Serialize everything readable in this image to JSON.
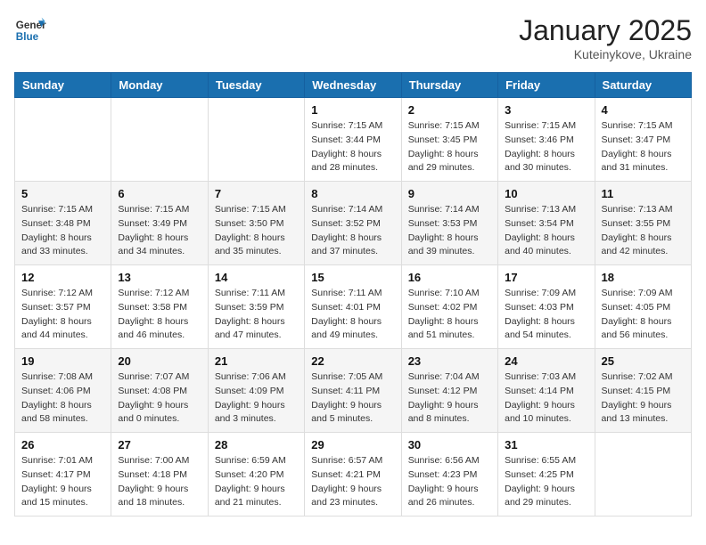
{
  "header": {
    "logo_general": "General",
    "logo_blue": "Blue",
    "month_title": "January 2025",
    "location": "Kuteinykove, Ukraine"
  },
  "days_of_week": [
    "Sunday",
    "Monday",
    "Tuesday",
    "Wednesday",
    "Thursday",
    "Friday",
    "Saturday"
  ],
  "weeks": [
    [
      {
        "day": "",
        "info": ""
      },
      {
        "day": "",
        "info": ""
      },
      {
        "day": "",
        "info": ""
      },
      {
        "day": "1",
        "info": "Sunrise: 7:15 AM\nSunset: 3:44 PM\nDaylight: 8 hours\nand 28 minutes."
      },
      {
        "day": "2",
        "info": "Sunrise: 7:15 AM\nSunset: 3:45 PM\nDaylight: 8 hours\nand 29 minutes."
      },
      {
        "day": "3",
        "info": "Sunrise: 7:15 AM\nSunset: 3:46 PM\nDaylight: 8 hours\nand 30 minutes."
      },
      {
        "day": "4",
        "info": "Sunrise: 7:15 AM\nSunset: 3:47 PM\nDaylight: 8 hours\nand 31 minutes."
      }
    ],
    [
      {
        "day": "5",
        "info": "Sunrise: 7:15 AM\nSunset: 3:48 PM\nDaylight: 8 hours\nand 33 minutes."
      },
      {
        "day": "6",
        "info": "Sunrise: 7:15 AM\nSunset: 3:49 PM\nDaylight: 8 hours\nand 34 minutes."
      },
      {
        "day": "7",
        "info": "Sunrise: 7:15 AM\nSunset: 3:50 PM\nDaylight: 8 hours\nand 35 minutes."
      },
      {
        "day": "8",
        "info": "Sunrise: 7:14 AM\nSunset: 3:52 PM\nDaylight: 8 hours\nand 37 minutes."
      },
      {
        "day": "9",
        "info": "Sunrise: 7:14 AM\nSunset: 3:53 PM\nDaylight: 8 hours\nand 39 minutes."
      },
      {
        "day": "10",
        "info": "Sunrise: 7:13 AM\nSunset: 3:54 PM\nDaylight: 8 hours\nand 40 minutes."
      },
      {
        "day": "11",
        "info": "Sunrise: 7:13 AM\nSunset: 3:55 PM\nDaylight: 8 hours\nand 42 minutes."
      }
    ],
    [
      {
        "day": "12",
        "info": "Sunrise: 7:12 AM\nSunset: 3:57 PM\nDaylight: 8 hours\nand 44 minutes."
      },
      {
        "day": "13",
        "info": "Sunrise: 7:12 AM\nSunset: 3:58 PM\nDaylight: 8 hours\nand 46 minutes."
      },
      {
        "day": "14",
        "info": "Sunrise: 7:11 AM\nSunset: 3:59 PM\nDaylight: 8 hours\nand 47 minutes."
      },
      {
        "day": "15",
        "info": "Sunrise: 7:11 AM\nSunset: 4:01 PM\nDaylight: 8 hours\nand 49 minutes."
      },
      {
        "day": "16",
        "info": "Sunrise: 7:10 AM\nSunset: 4:02 PM\nDaylight: 8 hours\nand 51 minutes."
      },
      {
        "day": "17",
        "info": "Sunrise: 7:09 AM\nSunset: 4:03 PM\nDaylight: 8 hours\nand 54 minutes."
      },
      {
        "day": "18",
        "info": "Sunrise: 7:09 AM\nSunset: 4:05 PM\nDaylight: 8 hours\nand 56 minutes."
      }
    ],
    [
      {
        "day": "19",
        "info": "Sunrise: 7:08 AM\nSunset: 4:06 PM\nDaylight: 8 hours\nand 58 minutes."
      },
      {
        "day": "20",
        "info": "Sunrise: 7:07 AM\nSunset: 4:08 PM\nDaylight: 9 hours\nand 0 minutes."
      },
      {
        "day": "21",
        "info": "Sunrise: 7:06 AM\nSunset: 4:09 PM\nDaylight: 9 hours\nand 3 minutes."
      },
      {
        "day": "22",
        "info": "Sunrise: 7:05 AM\nSunset: 4:11 PM\nDaylight: 9 hours\nand 5 minutes."
      },
      {
        "day": "23",
        "info": "Sunrise: 7:04 AM\nSunset: 4:12 PM\nDaylight: 9 hours\nand 8 minutes."
      },
      {
        "day": "24",
        "info": "Sunrise: 7:03 AM\nSunset: 4:14 PM\nDaylight: 9 hours\nand 10 minutes."
      },
      {
        "day": "25",
        "info": "Sunrise: 7:02 AM\nSunset: 4:15 PM\nDaylight: 9 hours\nand 13 minutes."
      }
    ],
    [
      {
        "day": "26",
        "info": "Sunrise: 7:01 AM\nSunset: 4:17 PM\nDaylight: 9 hours\nand 15 minutes."
      },
      {
        "day": "27",
        "info": "Sunrise: 7:00 AM\nSunset: 4:18 PM\nDaylight: 9 hours\nand 18 minutes."
      },
      {
        "day": "28",
        "info": "Sunrise: 6:59 AM\nSunset: 4:20 PM\nDaylight: 9 hours\nand 21 minutes."
      },
      {
        "day": "29",
        "info": "Sunrise: 6:57 AM\nSunset: 4:21 PM\nDaylight: 9 hours\nand 23 minutes."
      },
      {
        "day": "30",
        "info": "Sunrise: 6:56 AM\nSunset: 4:23 PM\nDaylight: 9 hours\nand 26 minutes."
      },
      {
        "day": "31",
        "info": "Sunrise: 6:55 AM\nSunset: 4:25 PM\nDaylight: 9 hours\nand 29 minutes."
      },
      {
        "day": "",
        "info": ""
      }
    ]
  ]
}
